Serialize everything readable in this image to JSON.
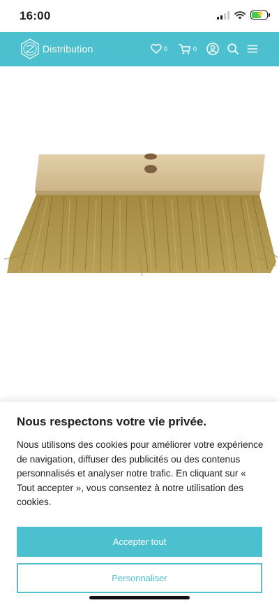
{
  "status_bar": {
    "time": "16:00",
    "battery_charging": true
  },
  "header": {
    "brand": "Distribution",
    "background_color": "#4cc0cf",
    "wishlist_count": "0",
    "cart_count": "0",
    "icons": [
      "heart-icon",
      "cart-icon",
      "account-icon",
      "search-icon",
      "menu-icon"
    ]
  },
  "product": {
    "image": "broom-head-icon"
  },
  "cookie": {
    "title": "Nous respectons votre vie privée.",
    "text": "Nous utilisons des cookies pour améliorer votre expérience de navigation, diffuser des publicités ou des contenus personnalisés et analyser notre trafic. En cliquant sur « Tout accepter », vous consentez à notre utilisation des cookies.",
    "accept_label": "Accepter tout",
    "customize_label": "Personnaliser",
    "accent_color": "#4cc0cf"
  }
}
